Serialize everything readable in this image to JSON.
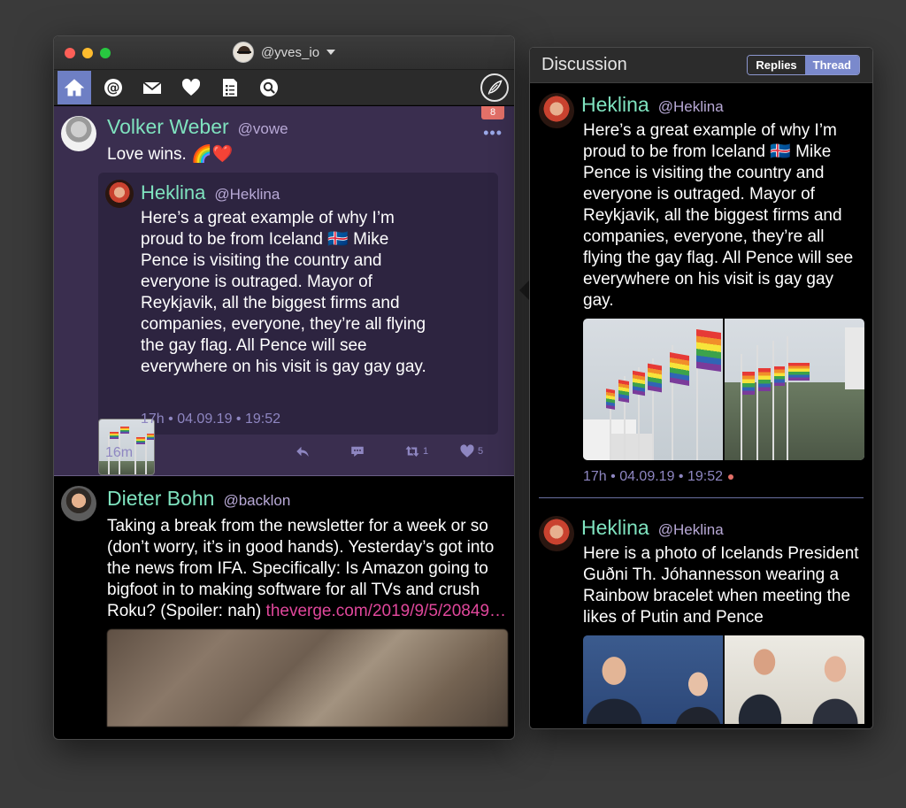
{
  "main_window": {
    "account": {
      "handle": "@yves_io"
    },
    "toolbar": {
      "items": [
        {
          "icon": "home-icon",
          "active": true
        },
        {
          "icon": "mentions-icon"
        },
        {
          "icon": "messages-icon"
        },
        {
          "icon": "favorites-icon"
        },
        {
          "icon": "lists-icon"
        },
        {
          "icon": "search-icon"
        }
      ],
      "compose_icon": "compose-feather-icon"
    },
    "posts": [
      {
        "author": "Volker Weber",
        "handle": "@vowe",
        "text": "Love wins. 🌈❤️",
        "badge": "8",
        "more": "•••",
        "time": "16m",
        "actions": {
          "reply": "",
          "quote": "",
          "retweet_count": "1",
          "like_count": "5"
        },
        "quoted": {
          "author": "Heklina",
          "handle": "@Heklina",
          "text": "Here’s a great example of why I’m proud to be from Iceland 🇮🇸 Mike Pence is visiting the country and everyone is outraged. Mayor of Reykjavik, all the biggest firms and companies, everyone, they’re all flying the gay flag. All Pence will see everywhere on his visit is gay gay gay.",
          "meta": "17h • 04.09.19 • 19:52"
        }
      },
      {
        "author": "Dieter Bohn",
        "handle": "@backlon",
        "text": "Taking a break from the newsletter for a week or so (don’t worry, it’s in good hands). Yesterday’s got into the news from IFA. Specifically: Is Amazon going to bigfoot in to making software for all TVs and crush Roku? (Spoiler: nah) ",
        "link": "theverge.com/2019/9/5/20849…"
      }
    ]
  },
  "discussion": {
    "title": "Discussion",
    "segments": [
      "Replies",
      "Thread"
    ],
    "selected_segment": "Thread",
    "posts": [
      {
        "author": "Heklina",
        "handle": "@Heklina",
        "text": "Here’s a great example of why I’m proud to be from Iceland 🇮🇸 Mike Pence is visiting the country and everyone is outraged. Mayor of Reykjavik, all the biggest firms and companies, everyone, they’re all flying the gay flag. All Pence will see everywhere on his visit is gay gay gay.",
        "meta": "17h • 04.09.19 • 19:52"
      },
      {
        "author": "Heklina",
        "handle": "@Heklina",
        "text": "Here is a photo of Icelands President Guðni Th. Jóhannesson wearing a Rainbow bracelet when meeting the likes of Putin and Pence"
      }
    ]
  },
  "colors": {
    "accent": "#7a89cc",
    "name": "#7fe3bf",
    "handle": "#b8a9d6",
    "link": "#e0479b",
    "selected_bg": "#3a2e4f",
    "badge": "#e37068"
  }
}
